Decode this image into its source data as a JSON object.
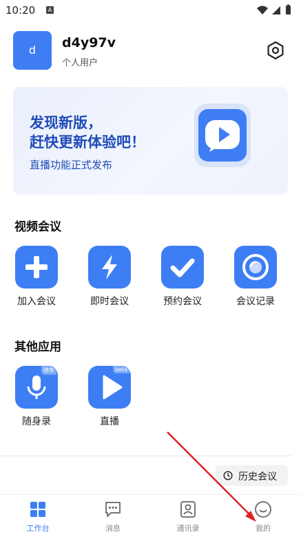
{
  "status_bar": {
    "time": "10:20",
    "notification": "A"
  },
  "profile": {
    "avatar_letter": "d",
    "username": "d4y97v",
    "user_type": "个人用户"
  },
  "banner": {
    "line1": "发现新版，",
    "line2": "赶快更新体验吧！",
    "subtitle": "直播功能正式发布"
  },
  "video_meeting": {
    "title": "视频会议",
    "items": [
      {
        "label": "加入会议",
        "icon": "plus-icon"
      },
      {
        "label": "即时会议",
        "icon": "lightning-icon"
      },
      {
        "label": "预约会议",
        "icon": "check-icon"
      },
      {
        "label": "会议记录",
        "icon": "record-icon"
      }
    ]
  },
  "other_apps": {
    "title": "其他应用",
    "items": [
      {
        "label": "随身录",
        "icon": "microphone-icon",
        "tag": "随免"
      },
      {
        "label": "直播",
        "icon": "play-icon",
        "tag": "beta"
      }
    ]
  },
  "history_button": {
    "label": "历史会议",
    "icon": "clock-icon"
  },
  "tab_bar": {
    "active": "工作台",
    "items": [
      {
        "label": "工作台",
        "icon": "grid-icon"
      },
      {
        "label": "消息",
        "icon": "chat-icon"
      },
      {
        "label": "通讯录",
        "icon": "contacts-icon"
      },
      {
        "label": "我的",
        "icon": "smile-icon"
      }
    ]
  },
  "colors": {
    "accent": "#3d7ef5",
    "banner_text": "#1f4bb8",
    "annotation_arrow": "#e02020"
  }
}
